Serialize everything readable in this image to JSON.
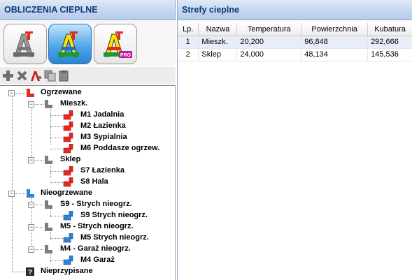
{
  "left_panel": {
    "title": "OBLICZENIA CIEPLNE",
    "modes": [
      {
        "icon": "area-calc-icon",
        "active": false
      },
      {
        "icon": "heat-calc-icon",
        "active": true
      },
      {
        "icon": "pro-calc-icon",
        "active": false,
        "badge": "PRO"
      }
    ],
    "toolbar": [
      "add-icon",
      "delete-icon",
      "rename-icon",
      "copy-icon",
      "paste-icon"
    ],
    "tree": [
      {
        "label": "Ogrzewane",
        "level": 0,
        "icon": "heated-group-icon"
      },
      {
        "label": "Mieszk.",
        "level": 1,
        "icon": "zone-icon"
      },
      {
        "label": "M1 Jadalnia",
        "level": 2,
        "icon": "heated-room-icon"
      },
      {
        "label": "M2 Łazienka",
        "level": 2,
        "icon": "heated-room-icon"
      },
      {
        "label": "M3 Sypialnia",
        "level": 2,
        "icon": "heated-room-icon"
      },
      {
        "label": "M6 Poddasze ogrzew.",
        "level": 2,
        "icon": "heated-room-icon"
      },
      {
        "label": "Sklep",
        "level": 1,
        "icon": "zone-icon"
      },
      {
        "label": "S7 Łazienka",
        "level": 2,
        "icon": "heated-room-icon"
      },
      {
        "label": "S8 Hala",
        "level": 2,
        "icon": "heated-room-icon"
      },
      {
        "label": "Nieogrzewane",
        "level": 0,
        "icon": "unheated-group-icon"
      },
      {
        "label": "S9 - Strych nieogrz.",
        "level": 1,
        "icon": "zone-icon"
      },
      {
        "label": "S9 Strych nieogrz.",
        "level": 2,
        "icon": "unheated-room-icon"
      },
      {
        "label": "M5 - Strych nieogrz.",
        "level": 1,
        "icon": "zone-icon"
      },
      {
        "label": "M5 Strych nieogrz.",
        "level": 2,
        "icon": "unheated-room-icon"
      },
      {
        "label": "M4 - Garaż nieogrz.",
        "level": 1,
        "icon": "zone-icon"
      },
      {
        "label": "M4 Garaż",
        "level": 2,
        "icon": "unheated-room-icon"
      },
      {
        "label": "Nieprzypisane",
        "level": 0,
        "icon": "unassigned-icon"
      }
    ]
  },
  "right_panel": {
    "title": "Strefy cieplne",
    "columns": [
      "Lp.",
      "Nazwa",
      "Temperatura",
      "Powierzchnia",
      "Kubatura"
    ],
    "rows": [
      [
        "1",
        "Mieszk.",
        "20,200",
        "96,848",
        "292,666"
      ],
      [
        "2",
        "Sklep",
        "24,000",
        "48,134",
        "145,536"
      ]
    ]
  },
  "colors": {
    "header_text": "#10397a",
    "heated": "#e8291c",
    "unheated": "#2f84d6",
    "zone": "#7d7d7d"
  }
}
